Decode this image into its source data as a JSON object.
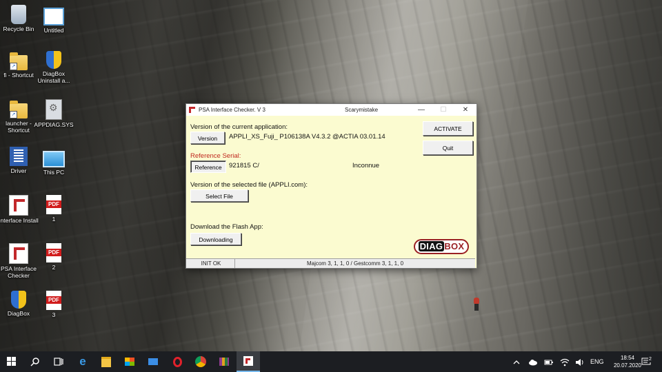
{
  "desktop": {
    "icons": [
      {
        "label": "Recycle Bin",
        "icon": "recycle-bin-icon"
      },
      {
        "label": "Untitled",
        "icon": "window-icon"
      },
      {
        "label": "fi - Shortcut",
        "icon": "folder-icon"
      },
      {
        "label": "DiagBox Uninstall a...",
        "icon": "shield-icon"
      },
      {
        "label": "launcher - Shortcut",
        "icon": "folder-icon"
      },
      {
        "label": "APPDIAG.SYS",
        "icon": "settings-file-icon"
      },
      {
        "label": "Driver",
        "icon": "driver-icon"
      },
      {
        "label": "This PC",
        "icon": "computer-icon"
      },
      {
        "label": "Interface Install",
        "icon": "installer-icon"
      },
      {
        "label": "1",
        "icon": "pdf-icon"
      },
      {
        "label": "PSA Interface Checker",
        "icon": "app-icon"
      },
      {
        "label": "2",
        "icon": "pdf-icon"
      },
      {
        "label": "DiagBox",
        "icon": "shield-icon"
      },
      {
        "label": "3",
        "icon": "pdf-icon"
      }
    ]
  },
  "dialog": {
    "title": "PSA Interface Checker. V 3",
    "subtitle": "Scarymistake",
    "controls": {
      "minimize": "—",
      "maximize": "☐",
      "close": "✕"
    },
    "current_app_label": "Version of the current application:",
    "version_button": "Version",
    "version_value": "APPLI_XS_Fuji_ P106138A  V4.3.2 @ACTIA 03.01.14",
    "reference_label": "Reference Serial:",
    "reference_button": "Reference",
    "reference_value": "921815  C/",
    "reference_status": "Inconnue",
    "selected_file_label": "Version of the selected file (APPLI.com):",
    "select_file_button": "Select File",
    "download_label": "Download the Flash App:",
    "downloading_button": "Downloading",
    "activate_button": "ACTIVATE",
    "quit_button": "Quit",
    "logo_diag": "DIAG",
    "logo_box": "BOX",
    "status_left": "INIT OK",
    "status_right": "Majcom 3, 1, 1, 0 / Gestcomm 3, 1, 1, 0"
  },
  "taskbar": {
    "language": "ENG",
    "time": "18:54",
    "date": "20.07.2020",
    "notification_count": "2"
  },
  "colors": {
    "dialog_bg": "#fbfbd0",
    "reference_label": "#c0271f",
    "taskbar_bg": "#1c1e22",
    "logo_red": "#9a2024"
  }
}
